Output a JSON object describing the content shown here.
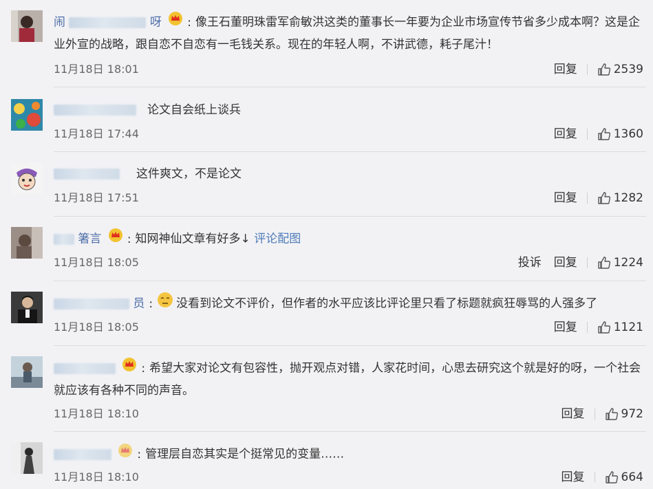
{
  "comments": [
    {
      "name_visible": "闹",
      "name_tail": "呀",
      "has_crown": true,
      "text": "像王石董明珠雷军俞敏洪这类的董事长一年要为企业市场宣传节省多少成本啊？这是企业外宣的战略，跟自恋不自恋有一毛钱关系。现在的年轻人啊，不讲武德，耗子尾汁！",
      "time": "11月18日 18:01",
      "reply": "回复",
      "likes": "2539"
    },
    {
      "name_visible": "",
      "name_tail": "",
      "has_crown": false,
      "text": "论文自会纸上谈兵",
      "time": "11月18日 17:44",
      "reply": "回复",
      "likes": "1360"
    },
    {
      "name_visible": "",
      "name_tail": "",
      "has_crown": false,
      "text": "这件爽文，不是论文",
      "time": "11月18日 17:51",
      "reply": "回复",
      "likes": "1282"
    },
    {
      "name_visible": "",
      "name_tail": "箸言",
      "has_crown": true,
      "text": "知网神仙文章有好多↓",
      "link": "评论配图",
      "time": "11月18日 18:05",
      "report": "投诉",
      "reply": "回复",
      "likes": "1224"
    },
    {
      "name_visible": "",
      "name_tail": "员",
      "has_crown": false,
      "emoji": "neutral-face-emoji",
      "text": "没看到论文不评价，但作者的水平应该比评论里只看了标题就疯狂辱骂的人强多了",
      "time": "11月18日 18:05",
      "reply": "回复",
      "likes": "1121"
    },
    {
      "name_visible": "",
      "name_tail": "",
      "has_crown": true,
      "text": "希望大家对论文有包容性，抛开观点对错，人家花时间，心思去研究这个就是好的呀，一个社会就应该有各种不同的声音。",
      "time": "11月18日 18:10",
      "reply": "回复",
      "likes": "972"
    },
    {
      "name_visible": "",
      "name_tail": "",
      "has_crown": false,
      "text": "管理层自恋其实是个挺常见的变量……",
      "time": "11月18日 18:10",
      "reply": "回复",
      "likes": "664"
    }
  ],
  "colors": {
    "link": "#4e7cb8",
    "username": "#4e6ea8",
    "background": "#f2f2f5"
  },
  "icons": {
    "like": "thumbs-up-icon",
    "crown": "crown-badge-icon"
  }
}
